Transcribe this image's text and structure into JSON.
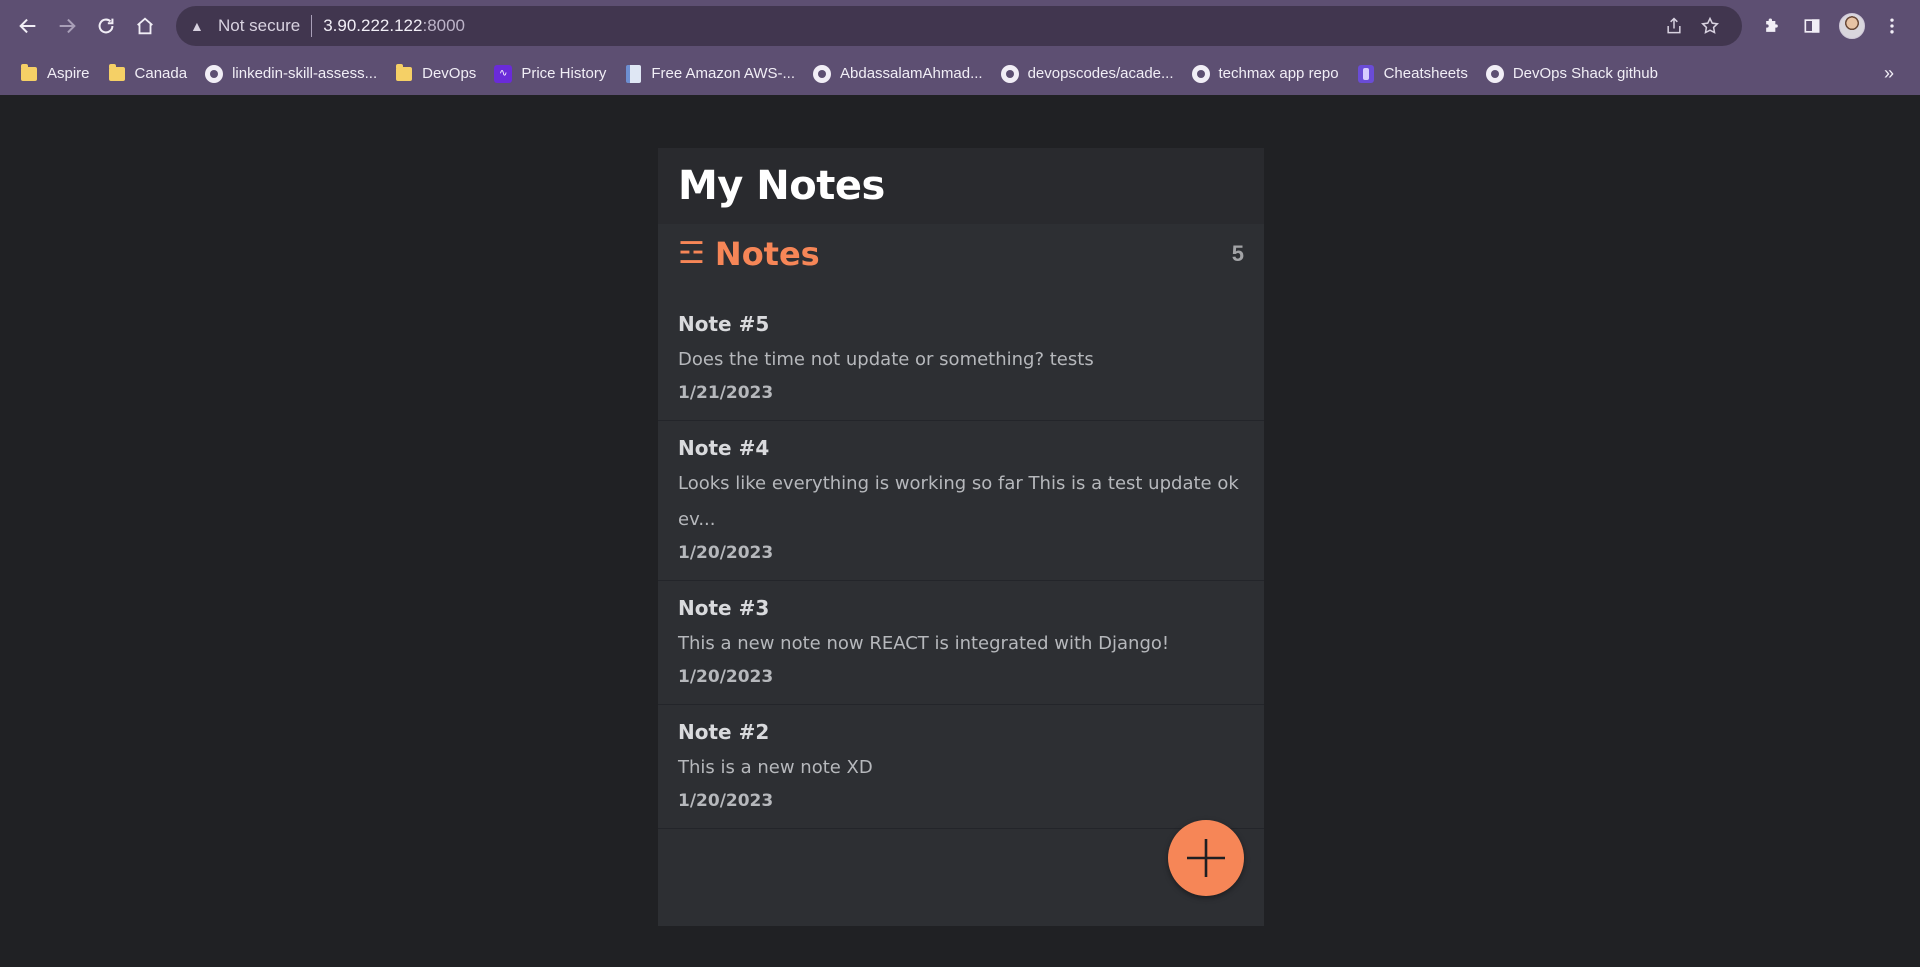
{
  "browser": {
    "omnibox": {
      "security_label": "Not secure",
      "host": "3.90.222.122",
      "port": ":8000"
    },
    "bookmarks": [
      {
        "label": "Aspire",
        "icon": "folder-icon"
      },
      {
        "label": "Canada",
        "icon": "folder-icon"
      },
      {
        "label": "linkedin-skill-assess...",
        "icon": "github-icon"
      },
      {
        "label": "DevOps",
        "icon": "folder-icon"
      },
      {
        "label": "Price History",
        "icon": "price-history-icon"
      },
      {
        "label": "Free Amazon AWS-...",
        "icon": "document-icon"
      },
      {
        "label": "AbdassalamAhmad...",
        "icon": "github-icon"
      },
      {
        "label": "devopscodes/acade...",
        "icon": "github-icon"
      },
      {
        "label": "techmax app repo",
        "icon": "github-icon"
      },
      {
        "label": "Cheatsheets",
        "icon": "cheatsheets-icon"
      },
      {
        "label": "DevOps Shack github",
        "icon": "github-icon"
      }
    ],
    "bookmarks_overflow": "»"
  },
  "app": {
    "title": "My Notes",
    "notes_header": {
      "icon": "☲",
      "title": "Notes",
      "count": "5"
    },
    "notes": [
      {
        "title": "Note #5",
        "body": "Does the time not update or something? tests",
        "date": "1/21/2023"
      },
      {
        "title": "Note #4",
        "body": "Looks like everything is working so far This is a test update ok ev...",
        "date": "1/20/2023"
      },
      {
        "title": "Note #3",
        "body": "This a new note now REACT is integrated with Django!",
        "date": "1/20/2023"
      },
      {
        "title": "Note #2",
        "body": "This is a new note XD",
        "date": "1/20/2023"
      }
    ],
    "accent_color": "#f68657",
    "fab_icon": "plus-icon"
  }
}
